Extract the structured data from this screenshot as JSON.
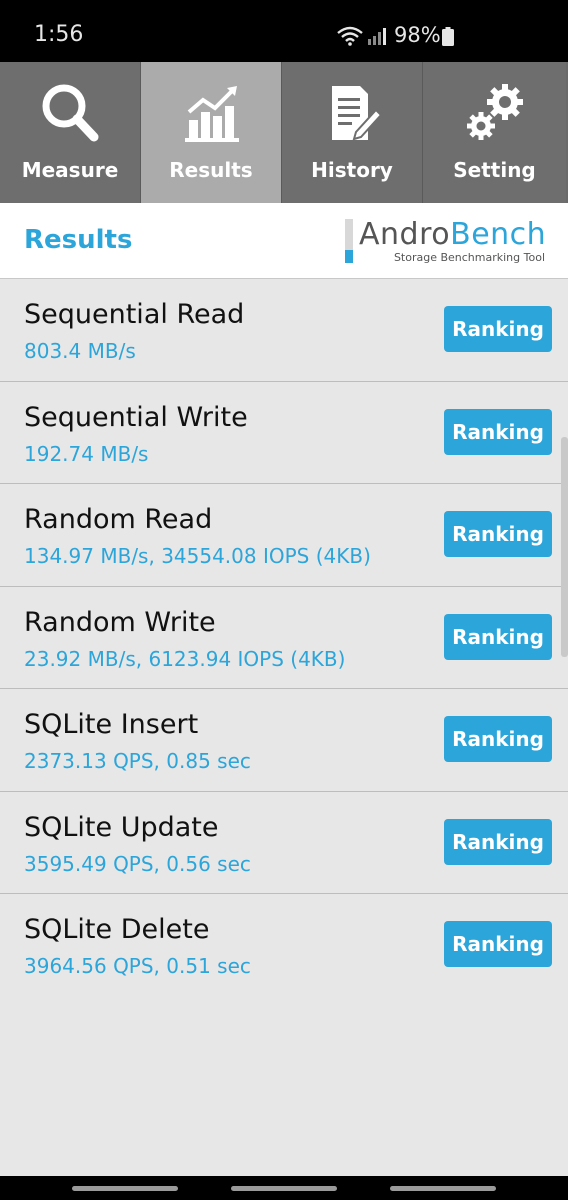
{
  "status_bar": {
    "time": "1:56",
    "battery": "98%"
  },
  "tabs": [
    {
      "label": "Measure",
      "icon": "search-icon",
      "active": false
    },
    {
      "label": "Results",
      "icon": "bar-chart-icon",
      "active": true
    },
    {
      "label": "History",
      "icon": "document-pen-icon",
      "active": false
    },
    {
      "label": "Setting",
      "icon": "gears-icon",
      "active": false
    }
  ],
  "header": {
    "title": "Results",
    "logo_part1": "Andro",
    "logo_part2": "Bench",
    "logo_tagline": "Storage Benchmarking Tool"
  },
  "results": [
    {
      "name": "Sequential Read",
      "value": "803.4 MB/s",
      "button": "Ranking"
    },
    {
      "name": "Sequential Write",
      "value": "192.74 MB/s",
      "button": "Ranking"
    },
    {
      "name": "Random Read",
      "value": "134.97 MB/s, 34554.08 IOPS (4KB)",
      "button": "Ranking"
    },
    {
      "name": "Random Write",
      "value": "23.92 MB/s, 6123.94 IOPS (4KB)",
      "button": "Ranking"
    },
    {
      "name": "SQLite Insert",
      "value": "2373.13 QPS, 0.85 sec",
      "button": "Ranking"
    },
    {
      "name": "SQLite Update",
      "value": "3595.49 QPS, 0.56 sec",
      "button": "Ranking"
    },
    {
      "name": "SQLite Delete",
      "value": "3964.56 QPS, 0.51 sec",
      "button": "Ranking"
    }
  ],
  "colors": {
    "accent": "#2ca5da",
    "tab_bg": "#6e6e6e",
    "tab_active_bg": "#ababab",
    "list_bg": "#e7e7e7"
  }
}
